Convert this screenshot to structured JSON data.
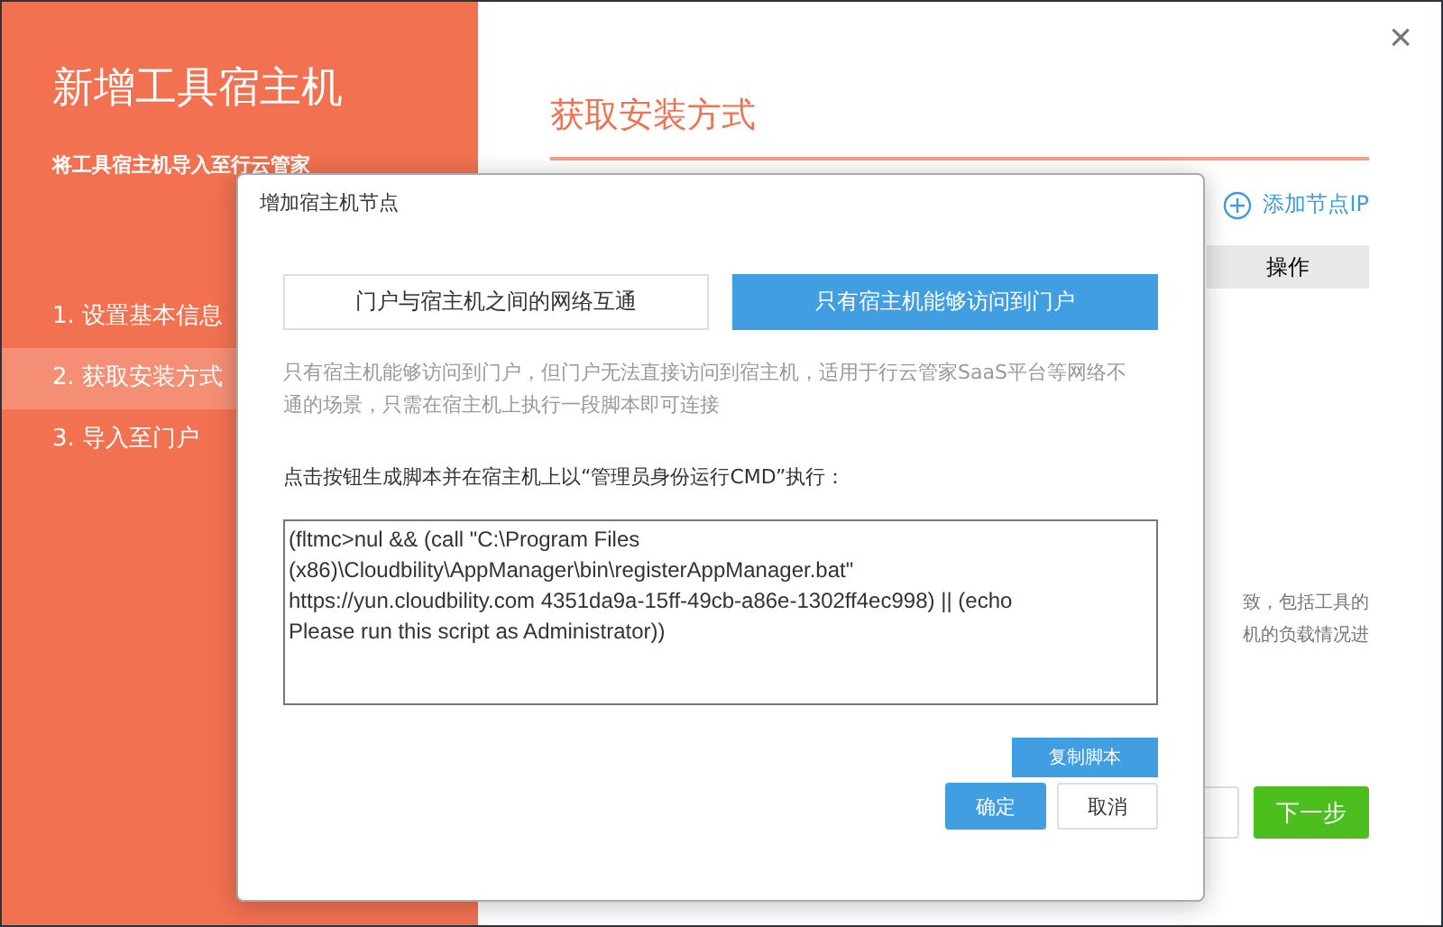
{
  "window": {
    "close": "×"
  },
  "sidebar": {
    "title": "新增工具宿主机",
    "subtitle": "将工具宿主机导入至行云管家",
    "steps": [
      {
        "label": "1. 设置基本信息",
        "selected": false
      },
      {
        "label": "2. 获取安装方式",
        "selected": true
      },
      {
        "label": "3. 导入至门户",
        "selected": false
      }
    ]
  },
  "main": {
    "heading": "获取安装方式",
    "add_link": "添加节点IP",
    "table": {
      "columns": [
        "操作"
      ]
    },
    "note_lines": [
      "致，包括工具的",
      "机的负载情况进"
    ],
    "buttons": [
      {
        "kind": "outline"
      },
      {
        "kind": "primary",
        "label": "下一步"
      }
    ]
  },
  "dialog": {
    "title": "增加宿主机节点",
    "tabs": [
      {
        "label": "门户与宿主机之间的网络互通",
        "selected": false
      },
      {
        "label": "只有宿主机能够访问到门户",
        "selected": true
      }
    ],
    "description": "只有宿主机能够访问到门户，但门户无法直接访问到宿主机，适用于行云管家SaaS平台等网络不通的场景，只需在宿主机上执行一段脚本即可连接",
    "instruction": "点击按钮生成脚本并在宿主机上以“管理员身份运行CMD”执行：",
    "script": "(fltmc>nul && (call \"C:\\Program Files (x86)\\Cloudbility\\AppManager\\bin\\registerAppManager.bat\" https://yun.cloudbility.com 4351da9a-15ff-49cb-a86e-1302ff4ec998) || (echo Please run this script as Administrator))",
    "copy_button": "复制脚本",
    "ok_button": "确定",
    "cancel_button": "取消"
  }
}
